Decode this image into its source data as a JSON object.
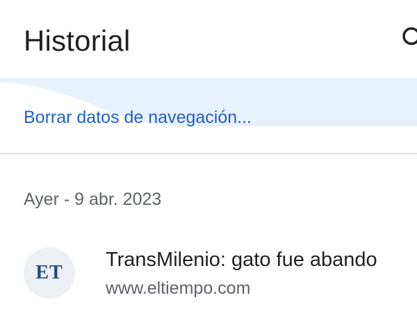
{
  "header": {
    "title": "Historial",
    "search_icon": "search-icon"
  },
  "clear_data": {
    "label": "Borrar datos de navegación..."
  },
  "history": {
    "groups": [
      {
        "date_label": "Ayer - 9 abr. 2023",
        "items": [
          {
            "favicon_text": "ET",
            "title": "TransMilenio: gato fue abando",
            "url": "www.eltiempo.com"
          }
        ]
      }
    ]
  },
  "colors": {
    "link": "#1f61c7",
    "band": "#e9f1fc",
    "favicon_bg": "#eceff3",
    "favicon_text": "#1d4c86"
  }
}
